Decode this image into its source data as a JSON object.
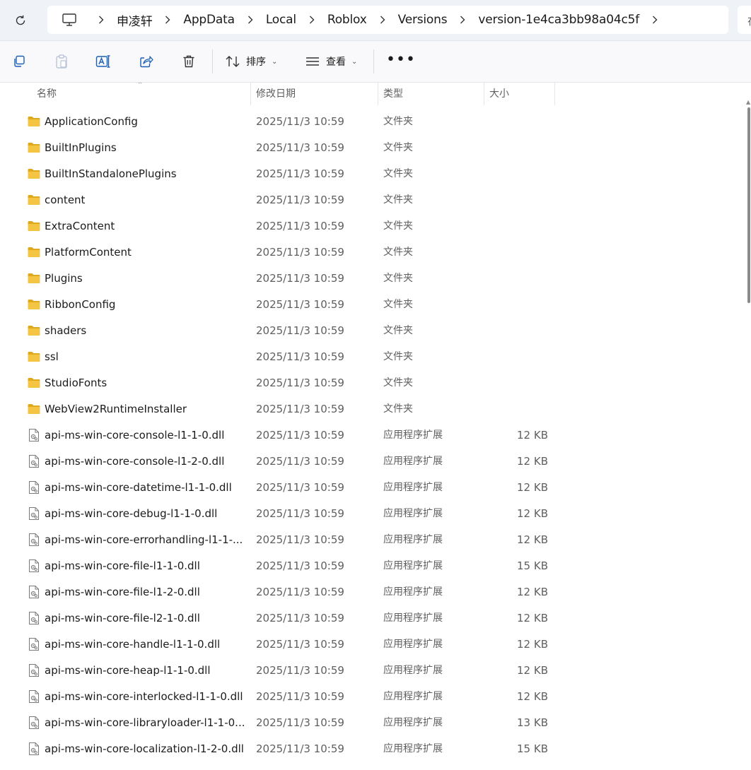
{
  "address_bar": {
    "breadcrumbs": [
      "申凌轩",
      "AppData",
      "Local",
      "Roblox",
      "Versions",
      "version-1e4ca3bb98a04c5f"
    ],
    "search_placeholder": "在"
  },
  "toolbar": {
    "sort_label": "排序",
    "view_label": "查看",
    "more_label": "•••"
  },
  "columns": {
    "name": "名称",
    "modified": "修改日期",
    "type": "类型",
    "size": "大小"
  },
  "files": [
    {
      "name": "ApplicationConfig",
      "modified": "2025/11/3 10:59",
      "type": "文件夹",
      "size": "",
      "kind": "folder"
    },
    {
      "name": "BuiltInPlugins",
      "modified": "2025/11/3 10:59",
      "type": "文件夹",
      "size": "",
      "kind": "folder"
    },
    {
      "name": "BuiltInStandalonePlugins",
      "modified": "2025/11/3 10:59",
      "type": "文件夹",
      "size": "",
      "kind": "folder"
    },
    {
      "name": "content",
      "modified": "2025/11/3 10:59",
      "type": "文件夹",
      "size": "",
      "kind": "folder"
    },
    {
      "name": "ExtraContent",
      "modified": "2025/11/3 10:59",
      "type": "文件夹",
      "size": "",
      "kind": "folder"
    },
    {
      "name": "PlatformContent",
      "modified": "2025/11/3 10:59",
      "type": "文件夹",
      "size": "",
      "kind": "folder"
    },
    {
      "name": "Plugins",
      "modified": "2025/11/3 10:59",
      "type": "文件夹",
      "size": "",
      "kind": "folder"
    },
    {
      "name": "RibbonConfig",
      "modified": "2025/11/3 10:59",
      "type": "文件夹",
      "size": "",
      "kind": "folder"
    },
    {
      "name": "shaders",
      "modified": "2025/11/3 10:59",
      "type": "文件夹",
      "size": "",
      "kind": "folder"
    },
    {
      "name": "ssl",
      "modified": "2025/11/3 10:59",
      "type": "文件夹",
      "size": "",
      "kind": "folder"
    },
    {
      "name": "StudioFonts",
      "modified": "2025/11/3 10:59",
      "type": "文件夹",
      "size": "",
      "kind": "folder"
    },
    {
      "name": "WebView2RuntimeInstaller",
      "modified": "2025/11/3 10:59",
      "type": "文件夹",
      "size": "",
      "kind": "folder"
    },
    {
      "name": "api-ms-win-core-console-l1-1-0.dll",
      "modified": "2025/11/3 10:59",
      "type": "应用程序扩展",
      "size": "12 KB",
      "kind": "dll"
    },
    {
      "name": "api-ms-win-core-console-l1-2-0.dll",
      "modified": "2025/11/3 10:59",
      "type": "应用程序扩展",
      "size": "12 KB",
      "kind": "dll"
    },
    {
      "name": "api-ms-win-core-datetime-l1-1-0.dll",
      "modified": "2025/11/3 10:59",
      "type": "应用程序扩展",
      "size": "12 KB",
      "kind": "dll"
    },
    {
      "name": "api-ms-win-core-debug-l1-1-0.dll",
      "modified": "2025/11/3 10:59",
      "type": "应用程序扩展",
      "size": "12 KB",
      "kind": "dll"
    },
    {
      "name": "api-ms-win-core-errorhandling-l1-1-...",
      "modified": "2025/11/3 10:59",
      "type": "应用程序扩展",
      "size": "12 KB",
      "kind": "dll"
    },
    {
      "name": "api-ms-win-core-file-l1-1-0.dll",
      "modified": "2025/11/3 10:59",
      "type": "应用程序扩展",
      "size": "15 KB",
      "kind": "dll"
    },
    {
      "name": "api-ms-win-core-file-l1-2-0.dll",
      "modified": "2025/11/3 10:59",
      "type": "应用程序扩展",
      "size": "12 KB",
      "kind": "dll"
    },
    {
      "name": "api-ms-win-core-file-l2-1-0.dll",
      "modified": "2025/11/3 10:59",
      "type": "应用程序扩展",
      "size": "12 KB",
      "kind": "dll"
    },
    {
      "name": "api-ms-win-core-handle-l1-1-0.dll",
      "modified": "2025/11/3 10:59",
      "type": "应用程序扩展",
      "size": "12 KB",
      "kind": "dll"
    },
    {
      "name": "api-ms-win-core-heap-l1-1-0.dll",
      "modified": "2025/11/3 10:59",
      "type": "应用程序扩展",
      "size": "12 KB",
      "kind": "dll"
    },
    {
      "name": "api-ms-win-core-interlocked-l1-1-0.dll",
      "modified": "2025/11/3 10:59",
      "type": "应用程序扩展",
      "size": "12 KB",
      "kind": "dll"
    },
    {
      "name": "api-ms-win-core-libraryloader-l1-1-0...",
      "modified": "2025/11/3 10:59",
      "type": "应用程序扩展",
      "size": "13 KB",
      "kind": "dll"
    },
    {
      "name": "api-ms-win-core-localization-l1-2-0.dll",
      "modified": "2025/11/3 10:59",
      "type": "应用程序扩展",
      "size": "15 KB",
      "kind": "dll"
    }
  ],
  "colors": {
    "folder": "#f4c542",
    "folder_dark": "#e0a81c",
    "toolbar_blue": "#1a5fb4",
    "topbar_bg": "#eff2f7"
  }
}
